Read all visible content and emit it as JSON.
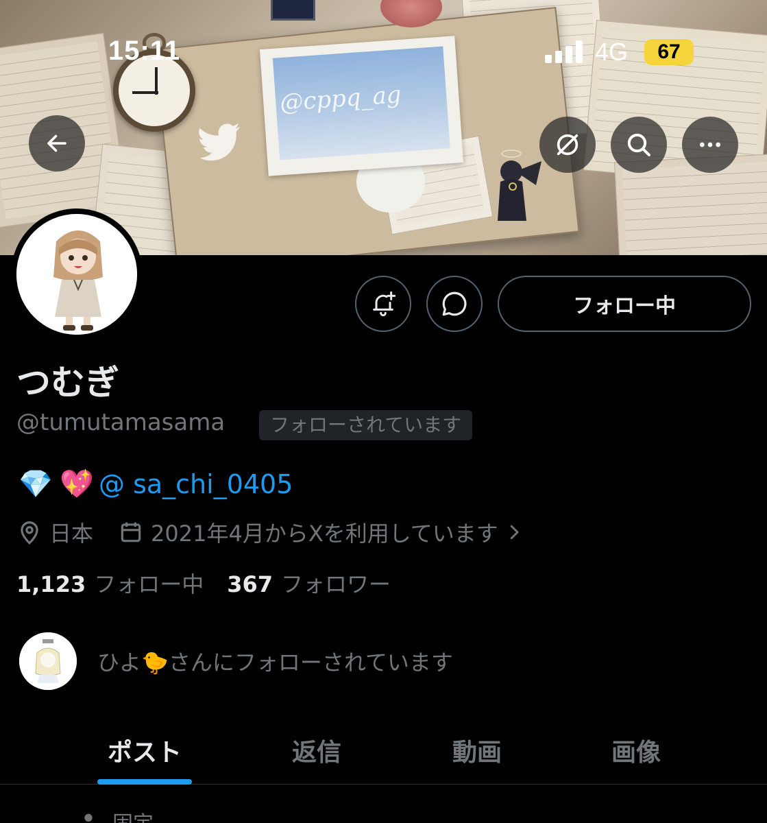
{
  "status_bar": {
    "time": "15:11",
    "network": "4G",
    "battery": "67"
  },
  "banner": {
    "watermark": "@cppq_ag"
  },
  "nav": {
    "back": "arrow-left-icon",
    "grok": "grok-icon",
    "search": "search-icon",
    "more": "more-icon"
  },
  "profile": {
    "display_name": "つむぎ",
    "handle": "@tumutamasama",
    "follows_you_badge": "フォローされています",
    "bio": {
      "emoji_1": "💎",
      "emoji_2": "💖",
      "mention": "@ sa_chi_0405"
    },
    "location": "日本",
    "joined": "2021年4月からXを利用しています",
    "following_count": "1,123",
    "following_label": "フォロー中",
    "followers_count": "367",
    "followers_label": "フォロワー",
    "followed_by": "ひよ🐤さんにフォローされています"
  },
  "actions": {
    "follow_button": "フォロー中",
    "notify_icon": "bell-plus-icon",
    "dm_icon": "message-icon"
  },
  "tabs": [
    "ポスト",
    "返信",
    "動画",
    "画像"
  ],
  "active_tab": 0,
  "pinned_label": "固定",
  "colors": {
    "accent": "#1d9bf0",
    "background": "#000000",
    "muted": "#71767b"
  }
}
